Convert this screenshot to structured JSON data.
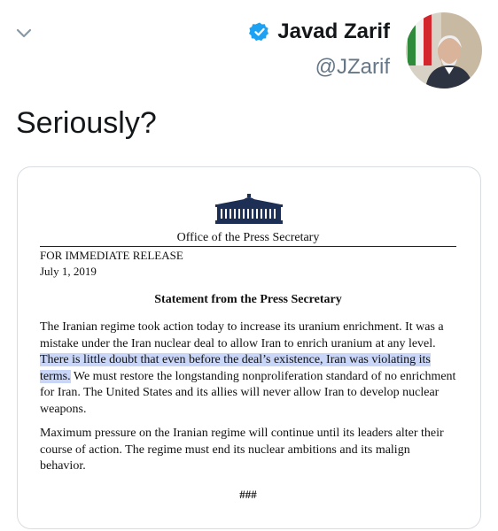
{
  "header": {
    "display_name": "Javad Zarif",
    "handle": "@JZarif",
    "verified_icon": "verified-badge-icon",
    "chevron_icon": "chevron-down-icon"
  },
  "tweet": {
    "text": "Seriously?"
  },
  "document": {
    "office": "Office of the Press Secretary",
    "release_label": "FOR IMMEDIATE RELEASE",
    "date": "July 1, 2019",
    "title": "Statement from the Press Secretary",
    "paragraph1": {
      "before_highlight": "The Iranian regime took action today to increase its uranium enrichment.  It was a mistake under the Iran nuclear deal to allow Iran to enrich uranium at any level.  ",
      "highlight": "There is little doubt that even before the deal’s existence, Iran was violating its terms.",
      "after_highlight": "  We must restore the longstanding nonproliferation standard of no enrichment for Iran.  The United States and its allies will never allow Iran to develop nuclear weapons."
    },
    "paragraph2": "Maximum pressure on the Iranian regime will continue until its leaders alter their course of action.  The regime must end its nuclear ambitions and its malign behavior.",
    "end_marker": "###"
  },
  "colors": {
    "verified_blue": "#1da1f2",
    "handle_gray": "#657786",
    "highlight": "#c9d6f7"
  }
}
